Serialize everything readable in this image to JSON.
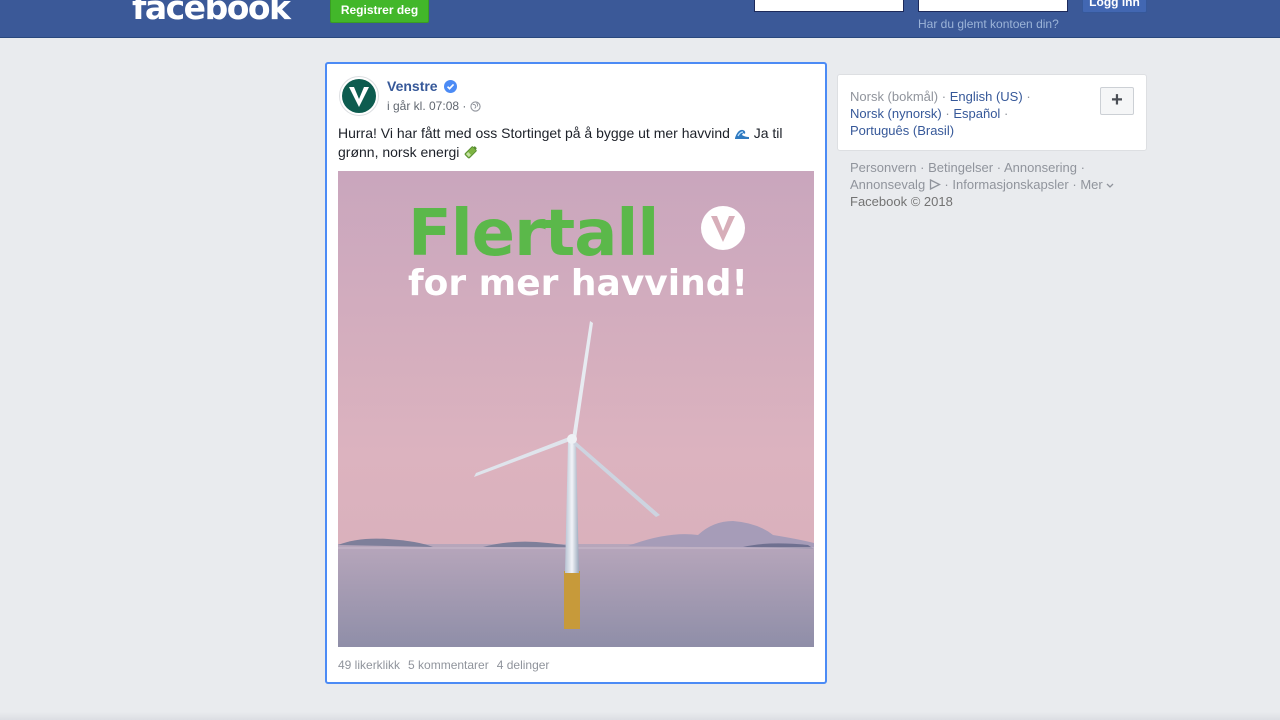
{
  "header": {
    "logo": "facebook",
    "register_label": "Registrer deg",
    "login_label": "Logg inn",
    "forgot_label": "Har du glemt kontoen din?",
    "email_value": "",
    "password_value": "",
    "bar_color": "#3b5998"
  },
  "post": {
    "author": "Venstre",
    "timestamp": "i går kl. 07:08 ·",
    "text_part1": "Hurra! Vi har fått med oss Stortinget på å bygge ut mer havvind",
    "text_part2": "Ja til grønn, norsk energi",
    "emoji1": "wave-icon",
    "emoji2": "battery-icon",
    "image": {
      "headline1": "Flertall",
      "headline2": "for mer havvind!",
      "logo_letter": "V"
    },
    "stats": {
      "likes": "49 likerklikk",
      "comments": "5 kommentarer",
      "shares": "4 delinger"
    }
  },
  "sidebar": {
    "languages": {
      "current": "Norsk (bokmål)",
      "lang1": "English (US)",
      "lang2": "Norsk (nynorsk)",
      "lang3": "Español",
      "lang4": "Português (Brasil)",
      "sep": "·",
      "add_label": "+"
    },
    "footer": {
      "privacy": "Personvern",
      "terms": "Betingelser",
      "ads": "Annonsering",
      "ad_choices": "Annonsevalg",
      "cookies": "Informasjonskapsler",
      "more": "Mer",
      "copyright": "Facebook © 2018"
    }
  }
}
